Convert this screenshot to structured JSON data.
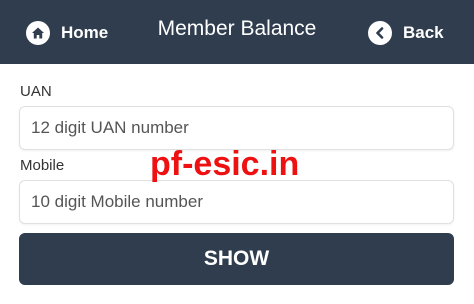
{
  "header": {
    "title": "Member Balance",
    "home_label": "Home",
    "back_label": "Back",
    "background_color": "#2f3d4e"
  },
  "form": {
    "uan_label": "UAN",
    "uan_placeholder": "12 digit UAN number",
    "mobile_label": "Mobile",
    "mobile_placeholder": "10 digit Mobile number",
    "submit_label": "SHOW"
  },
  "watermark": {
    "text": "pf-esic.in",
    "color": "#ee1111"
  },
  "icons": {
    "home": "home-icon",
    "back": "chevron-left-icon"
  }
}
